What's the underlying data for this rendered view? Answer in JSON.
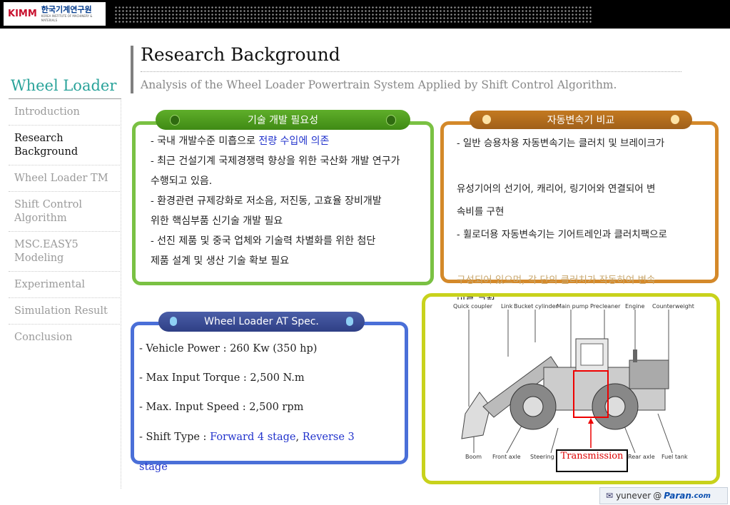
{
  "header": {
    "logo_abbr": "KIMM",
    "logo_korean": "한국기계연구원",
    "logo_english": "KOREA INSTITUTE OF MACHINERY & MATERIALS"
  },
  "page": {
    "title": "Research Background",
    "subtitle": "Analysis of the Wheel Loader Powertrain System Applied by Shift Control Algorithm."
  },
  "sidebar": {
    "title": "Wheel Loader",
    "items": [
      {
        "label": "Introduction"
      },
      {
        "label": "Research Background"
      },
      {
        "label": "Wheel Loader TM"
      },
      {
        "label": "Shift Control Algorithm"
      },
      {
        "label": "MSC.EASY5 Modeling"
      },
      {
        "label": "Experimental"
      },
      {
        "label": "Simulation Result"
      },
      {
        "label": "Conclusion"
      }
    ],
    "active_index": 1
  },
  "panel_need": {
    "heading": "기술 개발 필요성",
    "line1_a": "- 국내 개발수준 미흡으로 ",
    "line1_b": "전량 수입에 의존",
    "line2": "- 최근 건설기계 국제경쟁력 향상을 위한 국산화 개발 연구가",
    "line3": "수행되고 있음.",
    "line4": "- 환경관련 규제강화로 저소음, 저진동, 고효율  장비개발",
    "line5": " 위한 핵심부품 신기술 개발 필요",
    "line6": "- 선진 제품 및 중국 업체와 기술력 차별화를 위한 첨단",
    "line7": " 제품 설계 및 생산 기술 확보 필요",
    "color": "#7ac143"
  },
  "panel_compare": {
    "heading": "자동변속기 비교",
    "line1": "- 일반 승용차용 자동변속기는 클러치 및 브레이크가",
    "line2": "유성기어의 선기어, 캐리어, 링기어와 연결되어 변",
    "line3": "속비를 구현",
    "line4": "- 휠로더용 자동변속기는 기어트레인과 클러치팩으로",
    "line5": "구성되어 있으며, 각 단의 클러치가 작동하여 변속",
    "line6": "비를 구현",
    "color": "#d4892a"
  },
  "panel_spec": {
    "heading": "Wheel Loader AT Spec.",
    "power": "- Vehicle Power : 260 Kw (350 hp)",
    "torque": "- Max Input Torque : 2,500 N.m",
    "speed": "- Max. Input Speed : 2,500 rpm",
    "shift_label": "- Shift Type : ",
    "shift_forward": "Forward 4 stage",
    "shift_sep": ", ",
    "shift_reverse": "Reverse 3",
    "shift_tail": "stage",
    "color": "#4a6fd8"
  },
  "diagram": {
    "labels_top": [
      "Quick coupler",
      "Link",
      "Bucket cylinder",
      "Main pump",
      "Precleaner",
      "Engine",
      "Counterweight"
    ],
    "labels_bottom": [
      "Boom",
      "Front axle",
      "Steering",
      "Rear axle",
      "Fuel tank"
    ],
    "callout": "Transmission",
    "border_color": "#c8d21c"
  },
  "footer": {
    "user": "yunever",
    "at": "@",
    "brand": "Paran",
    "domain": ".com"
  }
}
